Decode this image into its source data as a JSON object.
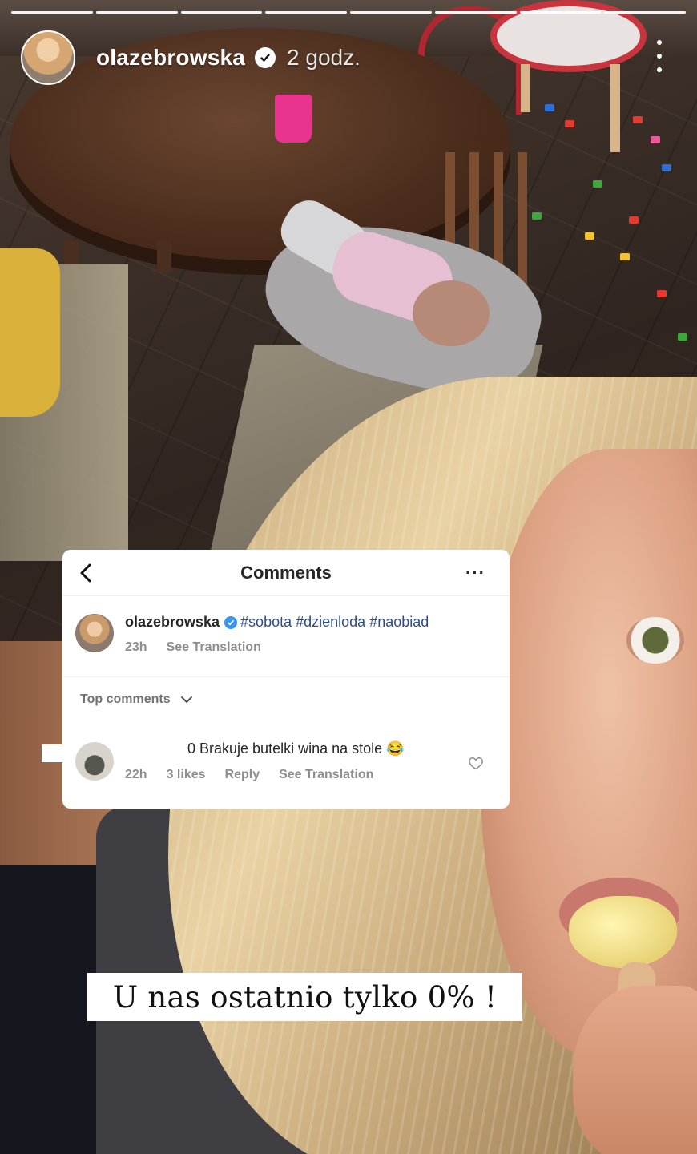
{
  "story": {
    "progress_segments": 8,
    "username": "olazebrowska",
    "time_ago": "2 godz."
  },
  "comments_card": {
    "title": "Comments",
    "post": {
      "username": "olazebrowska",
      "hashtags": "#sobota #dzienloda #naobiad",
      "age": "23h",
      "see_translation": "See Translation"
    },
    "top_comments_label": "Top comments",
    "comment": {
      "text": "0 Brakuje butelki wina na stole 😂",
      "age": "22h",
      "likes": "3 likes",
      "reply": "Reply",
      "see_translation": "See Translation"
    }
  },
  "caption": {
    "text": "U nas ostatnio tylko 0% !"
  },
  "colors": {
    "verified_blue": "#3897f0",
    "hashtag_blue": "#2b4c8c",
    "meta_gray": "#8e8e8e"
  }
}
